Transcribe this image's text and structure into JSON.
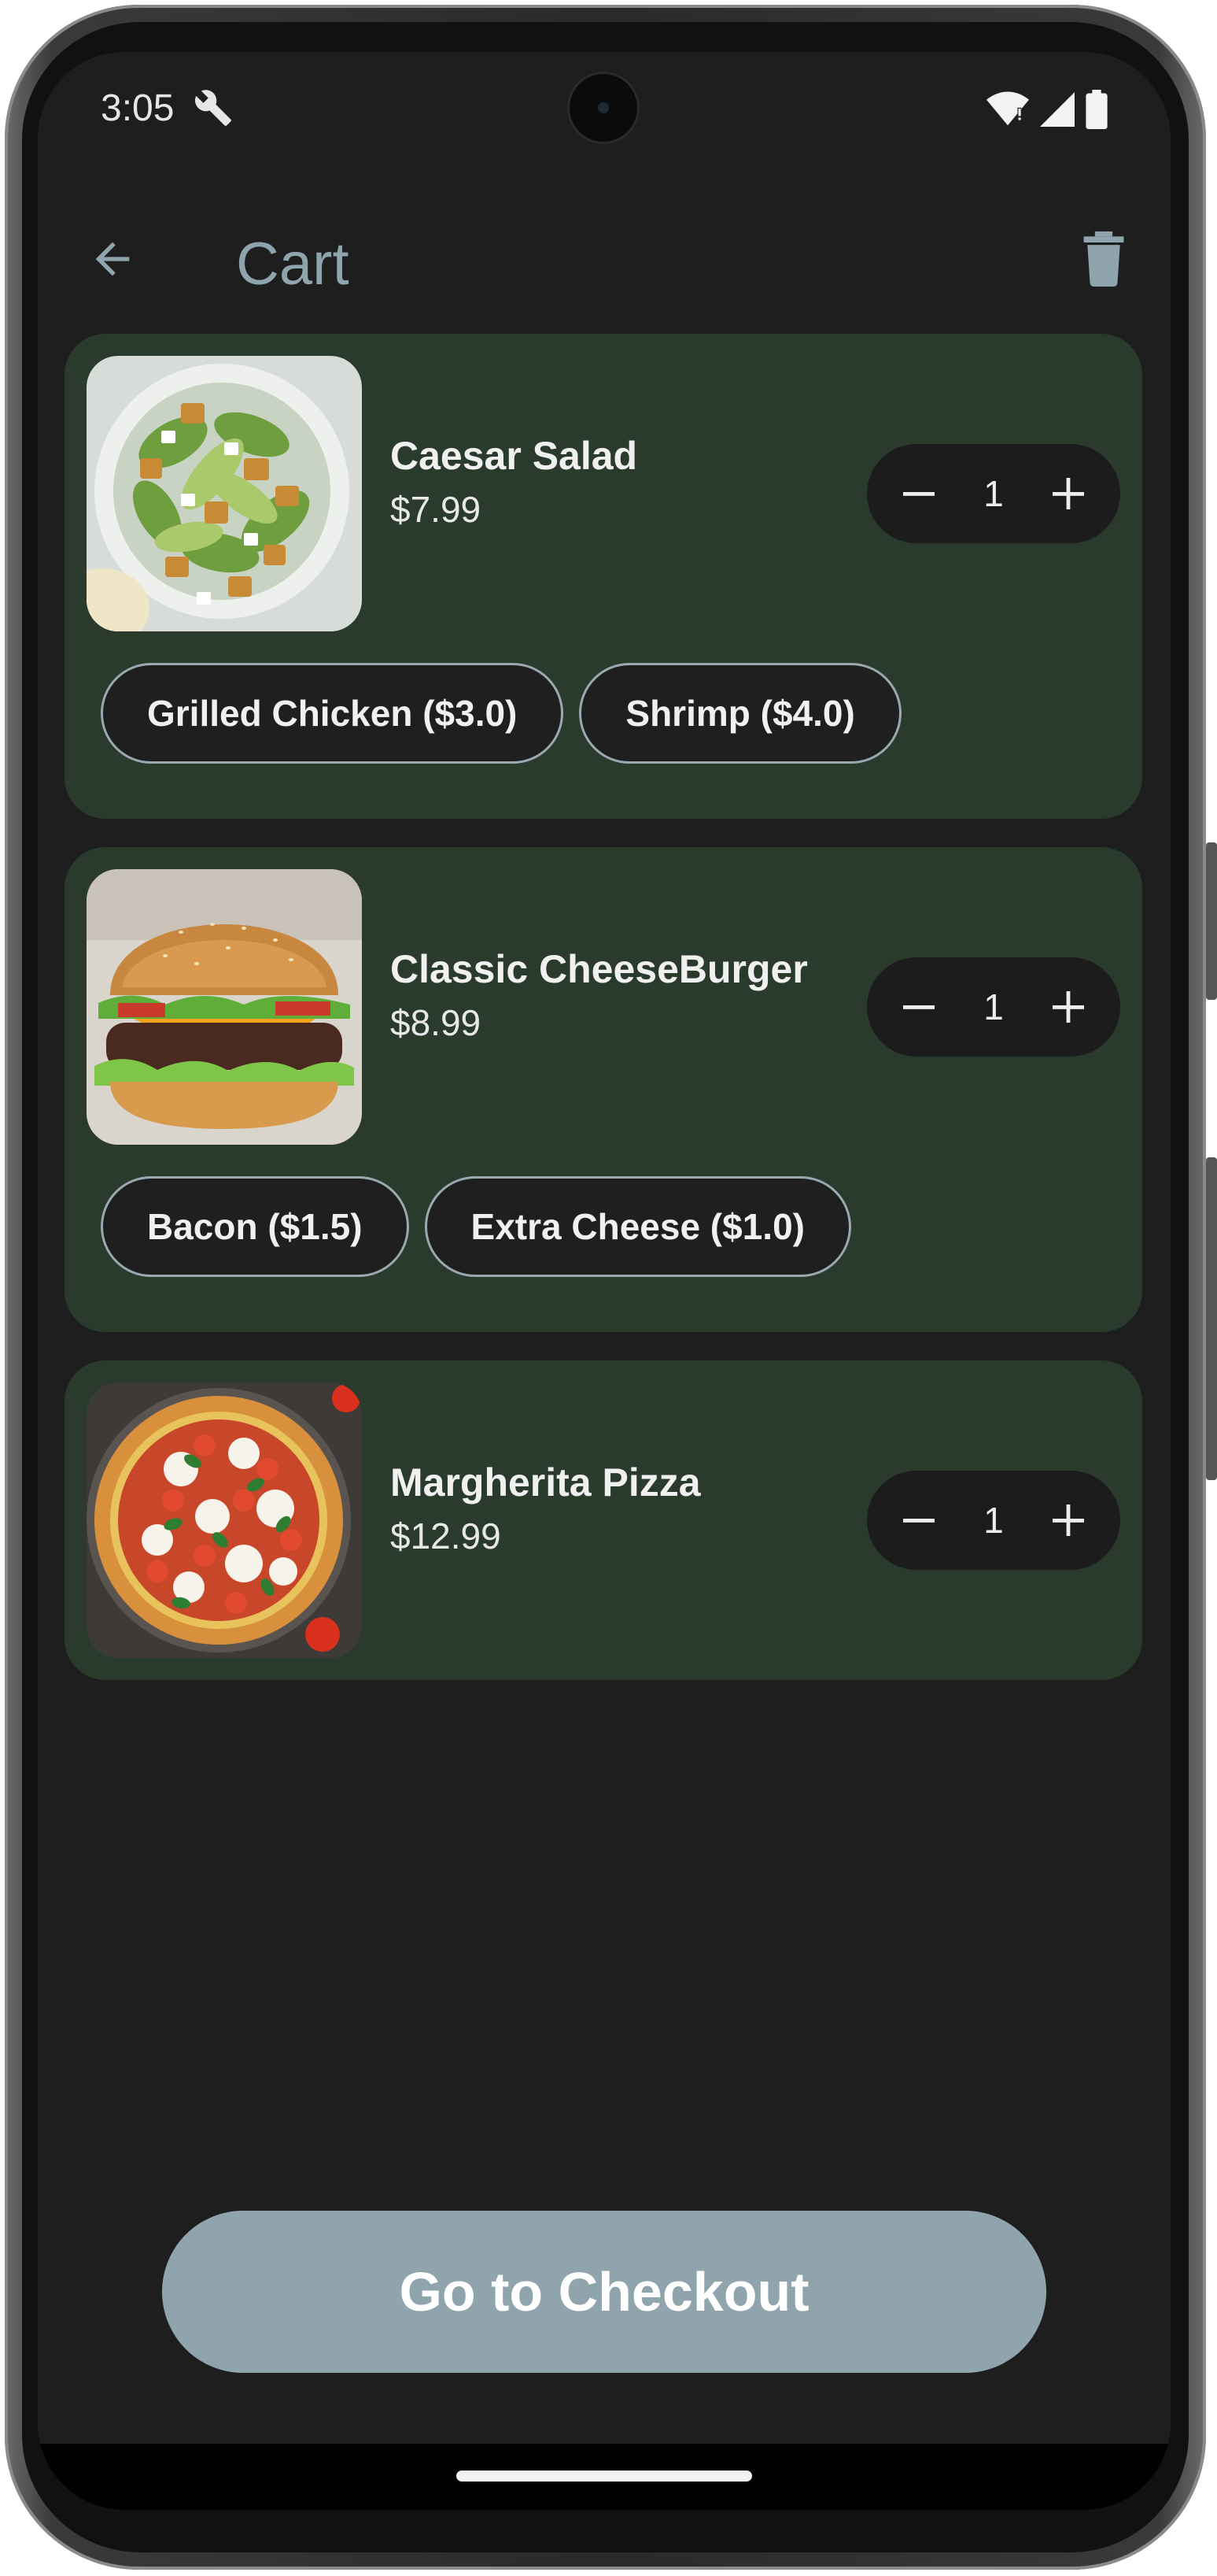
{
  "status_bar": {
    "time": "3:05",
    "icons": [
      "wrench-icon",
      "wifi-icon",
      "signal-icon",
      "battery-icon"
    ]
  },
  "app_bar": {
    "title": "Cart",
    "back_icon": "arrow-back-icon",
    "delete_icon": "trash-icon",
    "title_color": "#90a4ae"
  },
  "cart": {
    "items": [
      {
        "name": "Caesar Salad",
        "price": "$7.99",
        "quantity": "1",
        "image": "caesar-salad-image",
        "addons": [
          "Grilled Chicken ($3.0)",
          "Shrimp ($4.0)"
        ]
      },
      {
        "name": "Classic CheeseBurger",
        "price": "$8.99",
        "quantity": "1",
        "image": "cheeseburger-image",
        "addons": [
          "Bacon ($1.5)",
          "Extra Cheese ($1.0)"
        ]
      },
      {
        "name": "Margherita Pizza",
        "price": "$12.99",
        "quantity": "1",
        "image": "margherita-pizza-image",
        "addons": []
      }
    ]
  },
  "checkout": {
    "label": "Go to Checkout",
    "color": "#90a4ae"
  },
  "colors": {
    "background": "#1e1e1e",
    "card": "#2a3a2d",
    "stepper": "#1c1c1c",
    "chip_border": "#9aa8b0"
  }
}
